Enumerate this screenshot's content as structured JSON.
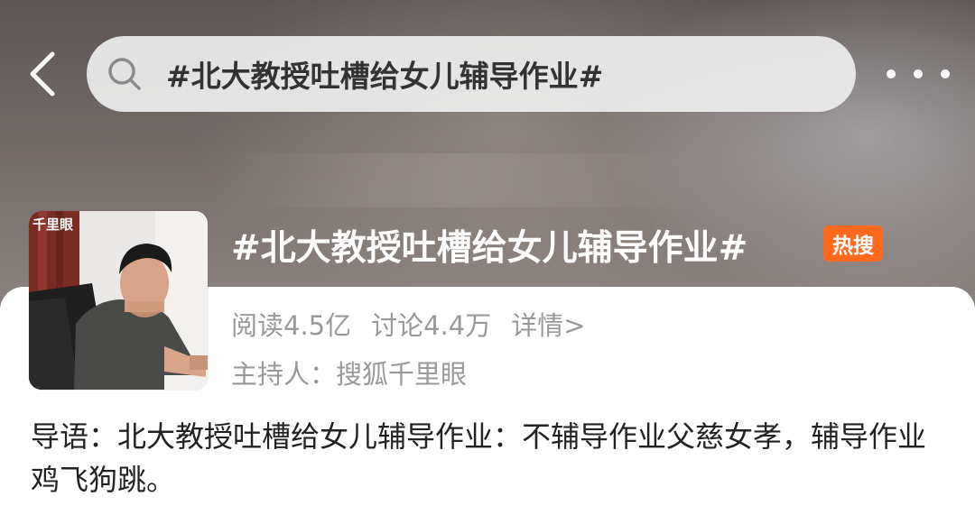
{
  "header": {
    "search_text": "#北大教授吐槽给女儿辅导作业#"
  },
  "topic": {
    "title": "#北大教授吐槽给女儿辅导作业#",
    "badge": "热搜",
    "badge_color": "#ff6a1e",
    "thumbnail_watermark": "千里眼",
    "reads": "阅读4.5亿",
    "discussions": "讨论4.4万",
    "detail_link": "详情>",
    "host": "主持人：搜狐千里眼",
    "intro": "导语：北大教授吐槽给女儿辅导作业：不辅导作业父慈女孝，辅导作业鸡飞狗跳。"
  },
  "icons": {
    "back": "chevron-left-icon",
    "search": "search-icon",
    "more": "more-horizontal-icon"
  }
}
